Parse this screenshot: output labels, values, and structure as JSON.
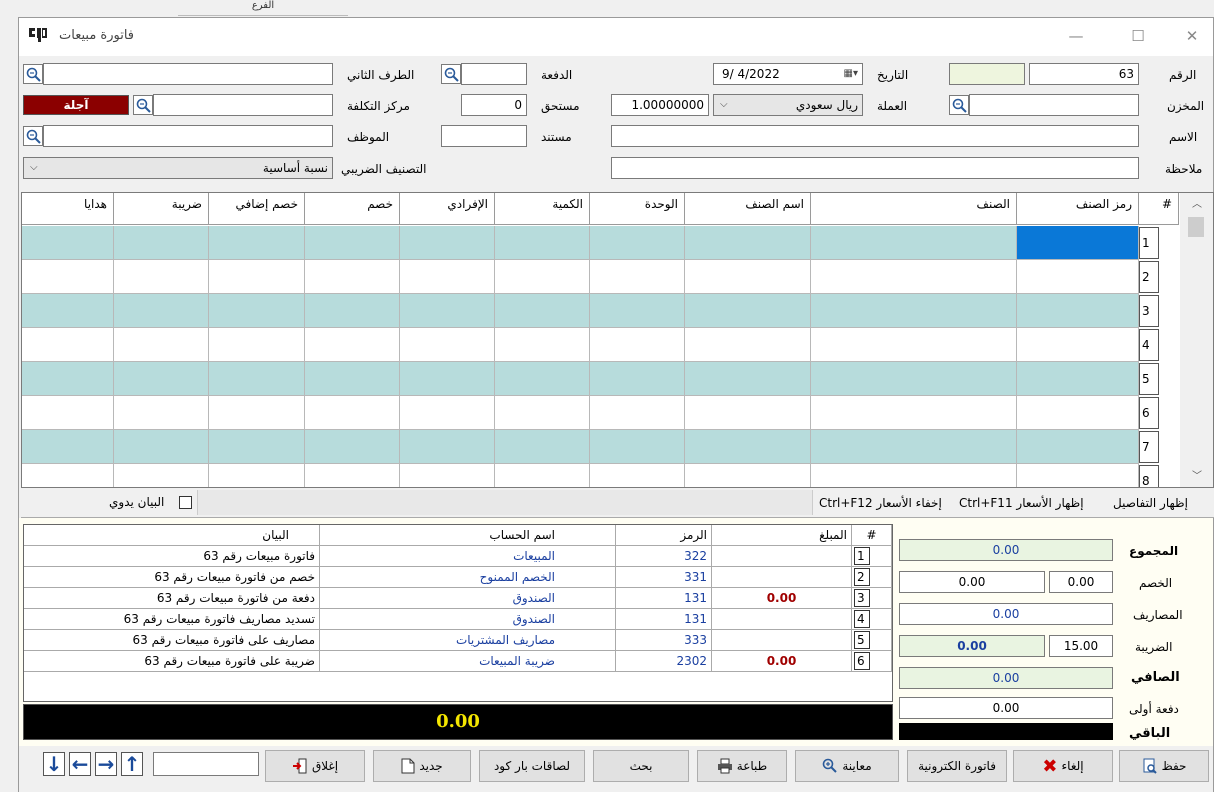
{
  "background": {
    "tab_label": "الفرع"
  },
  "window": {
    "title": "فاتورة مبيعات",
    "min": "—",
    "max": "☐",
    "close": "✕"
  },
  "header": {
    "number_label": "الرقم",
    "number_value": "63",
    "store_label": "المخزن",
    "store_value": "",
    "name_label": "الاسم",
    "name_value": "",
    "note_label": "ملاحظة",
    "note_value": "",
    "date_label": "التاريخ",
    "date_value": "9/ 4/2022",
    "currency_label": "العملة",
    "currency_value": "ريال سعودي",
    "rate_value": "1.00000000",
    "payment_label": "الدفعة",
    "payment_value": "",
    "due_label": "مستحق",
    "due_value": "0",
    "doc_label": "مستند",
    "doc_value": "",
    "party_label": "الطرف الثاني",
    "party_value": "",
    "cost_center_label": "مركز التكلفة",
    "cost_center_value": "",
    "deferred_label": "آجلة",
    "employee_label": "الموظف",
    "employee_value": "",
    "tax_class_label": "التصنيف الضريبي",
    "tax_class_value": "نسبة أساسية"
  },
  "grid": {
    "columns": [
      "#",
      "رمز الصنف",
      "الصنف",
      "اسم الصنف",
      "الوحدة",
      "الكمية",
      "الإفرادي",
      "خصم",
      "خصم إضافي",
      "ضريبة",
      "هدايا"
    ],
    "rows": [
      "1",
      "2",
      "3",
      "4",
      "5",
      "6",
      "7",
      "8"
    ]
  },
  "strip": {
    "show_details": "إظهار التفاصيل",
    "show_prices": "إظهار الأسعار Ctrl+F11",
    "hide_prices": "إخفاء الأسعار Ctrl+F12",
    "manual_statement": "البيان يدوي"
  },
  "ledger": {
    "headers": {
      "num": "#",
      "amount": "المبلغ",
      "code": "الرمز",
      "account": "اسم الحساب",
      "statement": "البيان"
    },
    "rows": [
      {
        "num": "1",
        "amount": "",
        "code": "322",
        "account": "المبيعات",
        "statement": "فاتورة مبيعات رقم 63"
      },
      {
        "num": "2",
        "amount": "",
        "code": "331",
        "account": "الخصم الممنوح",
        "statement": "خصم من فاتورة مبيعات رقم 63"
      },
      {
        "num": "3",
        "amount": "0.00",
        "code": "131",
        "account": "الصندوق",
        "statement": "دفعة من فاتورة مبيعات رقم 63"
      },
      {
        "num": "4",
        "amount": "",
        "code": "131",
        "account": "الصندوق",
        "statement": "تسديد مصاريف فاتورة مبيعات رقم 63"
      },
      {
        "num": "5",
        "amount": "",
        "code": "333",
        "account": "مصاريف المشتريات",
        "statement": "مصاريف على فاتورة مبيعات رقم 63"
      },
      {
        "num": "6",
        "amount": "0.00",
        "code": "2302",
        "account": "ضريبة المبيعات",
        "statement": "ضريبة على فاتورة مبيعات رقم 63"
      }
    ]
  },
  "totals": {
    "total_label": "المجموع",
    "total_value": "0.00",
    "discount_label": "الخصم",
    "discount_amount": "0.00",
    "discount_pct": "0.00",
    "expenses_label": "المصاريف",
    "expenses_value": "0.00",
    "tax_label": "الضريبة",
    "tax_value": "0.00",
    "tax_pct": "15.00",
    "net_label": "الصافي",
    "net_value": "0.00",
    "first_payment_label": "دفعة أولى",
    "first_payment_value": "0.00",
    "remaining_label": "الباقي",
    "remaining_value": "0.00"
  },
  "buttons": {
    "save": "حفظ",
    "cancel": "إلغاء",
    "einvoice": "فاتورة الكترونية",
    "preview": "معاينة",
    "print": "طباعة",
    "search": "بحث",
    "barcode": "لصاقات بار كود",
    "new": "جديد",
    "close": "إغلاق",
    "nav_value": ""
  },
  "colors": {
    "row_alt": "#b7dcdc",
    "selected": "#0a78d7",
    "deferred": "#8b0000",
    "account_blue": "#1a3fa0",
    "amount_red": "#a00000",
    "total_fill": "#e9f4e1"
  }
}
